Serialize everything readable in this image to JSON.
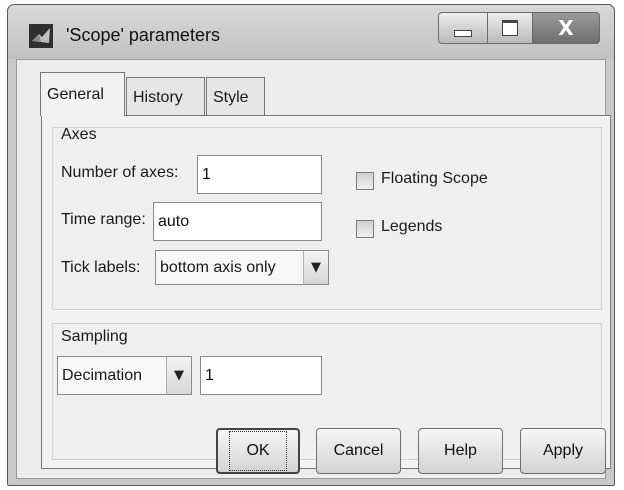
{
  "window": {
    "title": "'Scope' parameters",
    "icons": {
      "app": "matlab-icon",
      "minimize": "minimize-icon",
      "maximize": "maximize-icon",
      "close": "close-icon"
    },
    "close_glyph": "X"
  },
  "tabs": [
    {
      "label": "General",
      "selected": true
    },
    {
      "label": "History",
      "selected": false
    },
    {
      "label": "Style",
      "selected": false
    }
  ],
  "general": {
    "axes": {
      "title": "Axes",
      "number_of_axes_label": "Number of axes:",
      "number_of_axes_value": "1",
      "time_range_label": "Time range:",
      "time_range_value": "auto",
      "tick_labels_label": "Tick labels:",
      "tick_labels_selected": "bottom axis only",
      "floating_scope_label": "Floating Scope",
      "floating_scope_checked": false,
      "legends_label": "Legends",
      "legends_checked": false
    },
    "sampling": {
      "title": "Sampling",
      "mode_selected": "Decimation",
      "value": "1"
    }
  },
  "buttons": {
    "ok": "OK",
    "cancel": "Cancel",
    "help": "Help",
    "apply": "Apply"
  },
  "colors": {
    "dialog_bg": "#ececec",
    "titlebar": "#c9c9c9",
    "close_button": "#7a7a7a"
  }
}
